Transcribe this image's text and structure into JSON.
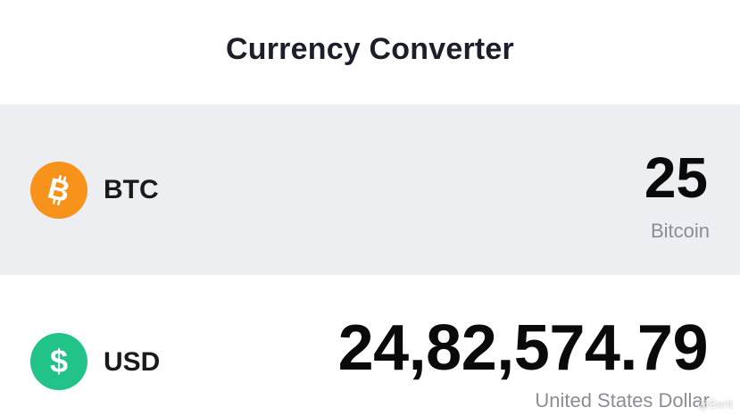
{
  "header": {
    "title": "Currency Converter"
  },
  "from_currency": {
    "code": "BTC",
    "amount": "25",
    "name": "Bitcoin",
    "icon": "bitcoin-icon",
    "icon_color": "#f7931a",
    "row_background": "#edeef1"
  },
  "to_currency": {
    "code": "USD",
    "amount": "24,82,574.79",
    "name": "United States Dollar",
    "icon": "dollar-icon",
    "icon_color": "#22c389"
  },
  "watermark": "@Berit"
}
